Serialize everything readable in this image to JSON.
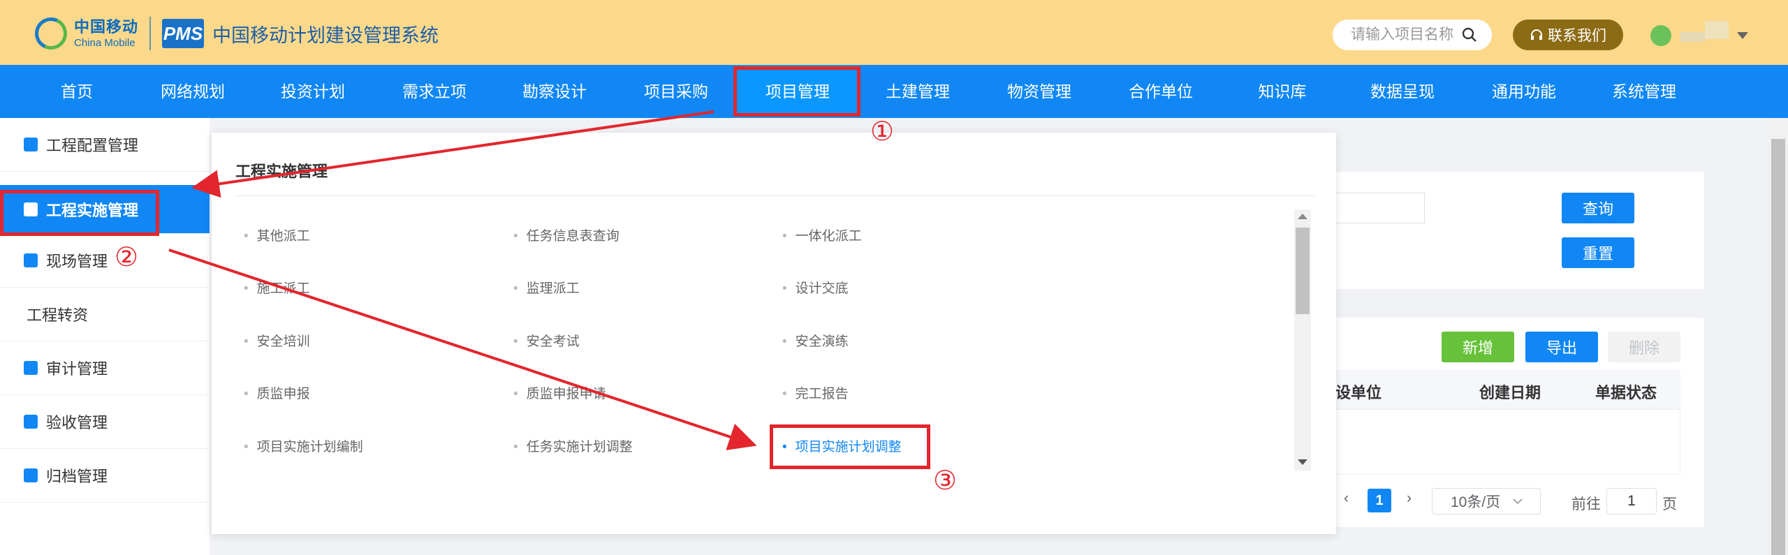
{
  "header": {
    "logo_cn": "中国移动",
    "logo_en": "China Mobile",
    "pms_badge": "PMS",
    "system_title": "中国移动计划建设管理系统",
    "search_placeholder": "请输入项目名称",
    "contact_label": "联系我们"
  },
  "nav": {
    "items": [
      "首页",
      "网络规划",
      "投资计划",
      "需求立项",
      "勘察设计",
      "项目采购",
      "项目管理",
      "土建管理",
      "物资管理",
      "合作单位",
      "知识库",
      "数据呈现",
      "通用功能",
      "系统管理"
    ],
    "active_index": 6
  },
  "sidebar": {
    "items": [
      "工程配置管理",
      "工程实施管理",
      "现场管理",
      "工程转资",
      "审计管理",
      "验收管理",
      "归档管理"
    ],
    "active_index": 1
  },
  "dropdown": {
    "title": "工程实施管理",
    "rows": [
      [
        "其他派工",
        "任务信息表查询",
        "一体化派工"
      ],
      [
        "施工派工",
        "监理派工",
        "设计交底"
      ],
      [
        "安全培训",
        "安全考试",
        "安全演练"
      ],
      [
        "质监申报",
        "质监申报申请",
        "完工报告"
      ],
      [
        "项目实施计划编制",
        "任务实施计划调整",
        "项目实施计划调整"
      ]
    ]
  },
  "filter": {
    "query_label": "查询",
    "reset_label": "重置"
  },
  "list": {
    "add_label": "新增",
    "export_label": "导出",
    "delete_label": "删除",
    "columns": [
      "设单位",
      "创建日期",
      "单据状态"
    ]
  },
  "pagination": {
    "current_page": "1",
    "page_size": "10条/页",
    "goto_prefix": "前往",
    "goto_value": "1",
    "goto_suffix": "页"
  },
  "annotations": [
    "①",
    "②",
    "③"
  ],
  "colors": {
    "header_bg": "#fcd98a",
    "nav_bg": "#1087f5",
    "annotation_red": "#e3262d",
    "add_green": "#67c23a"
  }
}
